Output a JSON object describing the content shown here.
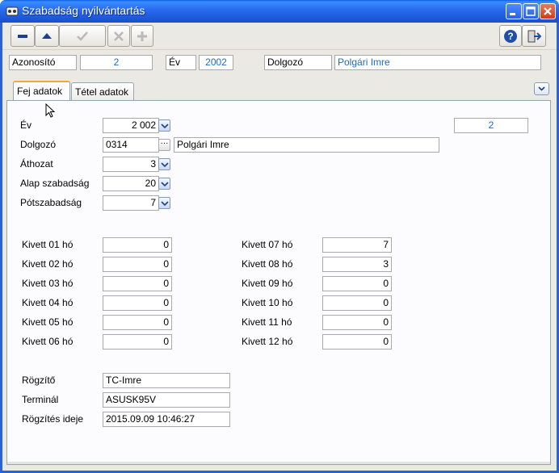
{
  "window": {
    "title": "Szabadság nyilvántartás",
    "accent": "#2a62d9"
  },
  "toolbar": {
    "buttons": [
      {
        "name": "minus-icon"
      },
      {
        "name": "up-arrow-icon"
      },
      {
        "name": "check-icon"
      },
      {
        "name": "x-icon"
      },
      {
        "name": "plus-icon"
      },
      {
        "name": "help-icon"
      },
      {
        "name": "exit-icon"
      }
    ]
  },
  "header": {
    "azonosito_label": "Azonosító",
    "azonosito_value": "2",
    "ev_label": "Év",
    "ev_value": "2002",
    "dolgozo_label": "Dolgozó",
    "dolgozo_value": "Polgári Imre"
  },
  "tabs": [
    {
      "label": "Fej adatok",
      "active": true
    },
    {
      "label": "Tétel adatok",
      "active": false
    }
  ],
  "form": {
    "ev": {
      "label": "Év",
      "value": "2 002"
    },
    "id_value": "2",
    "dolgozo": {
      "label": "Dolgozó",
      "code": "0314",
      "name": "Polgári Imre"
    },
    "athozat": {
      "label": "Áthozat",
      "value": "3"
    },
    "alap": {
      "label": "Alap szabadság",
      "value": "20"
    },
    "potszabadsag": {
      "label": "Pótszabadság",
      "value": "7"
    },
    "kivett_left": [
      {
        "label": "Kivett 01 hó",
        "value": "0"
      },
      {
        "label": "Kivett 02 hó",
        "value": "0"
      },
      {
        "label": "Kivett 03 hó",
        "value": "0"
      },
      {
        "label": "Kivett 04 hó",
        "value": "0"
      },
      {
        "label": "Kivett 05 hó",
        "value": "0"
      },
      {
        "label": "Kivett 06 hó",
        "value": "0"
      }
    ],
    "kivett_right": [
      {
        "label": "Kivett 07 hó",
        "value": "7"
      },
      {
        "label": "Kivett 08 hó",
        "value": "3"
      },
      {
        "label": "Kivett 09 hó",
        "value": "0"
      },
      {
        "label": "Kivett 10 hó",
        "value": "0"
      },
      {
        "label": "Kivett 11 hó",
        "value": "0"
      },
      {
        "label": "Kivett 12 hó",
        "value": "0"
      }
    ],
    "rogzito": {
      "label": "Rögzítő",
      "value": "TC-Imre"
    },
    "terminal": {
      "label": "Terminál",
      "value": "ASUSK95V"
    },
    "rogzites_ideje": {
      "label": "Rögzítés ideje",
      "value": "2015.09.09 10:46:27"
    }
  }
}
